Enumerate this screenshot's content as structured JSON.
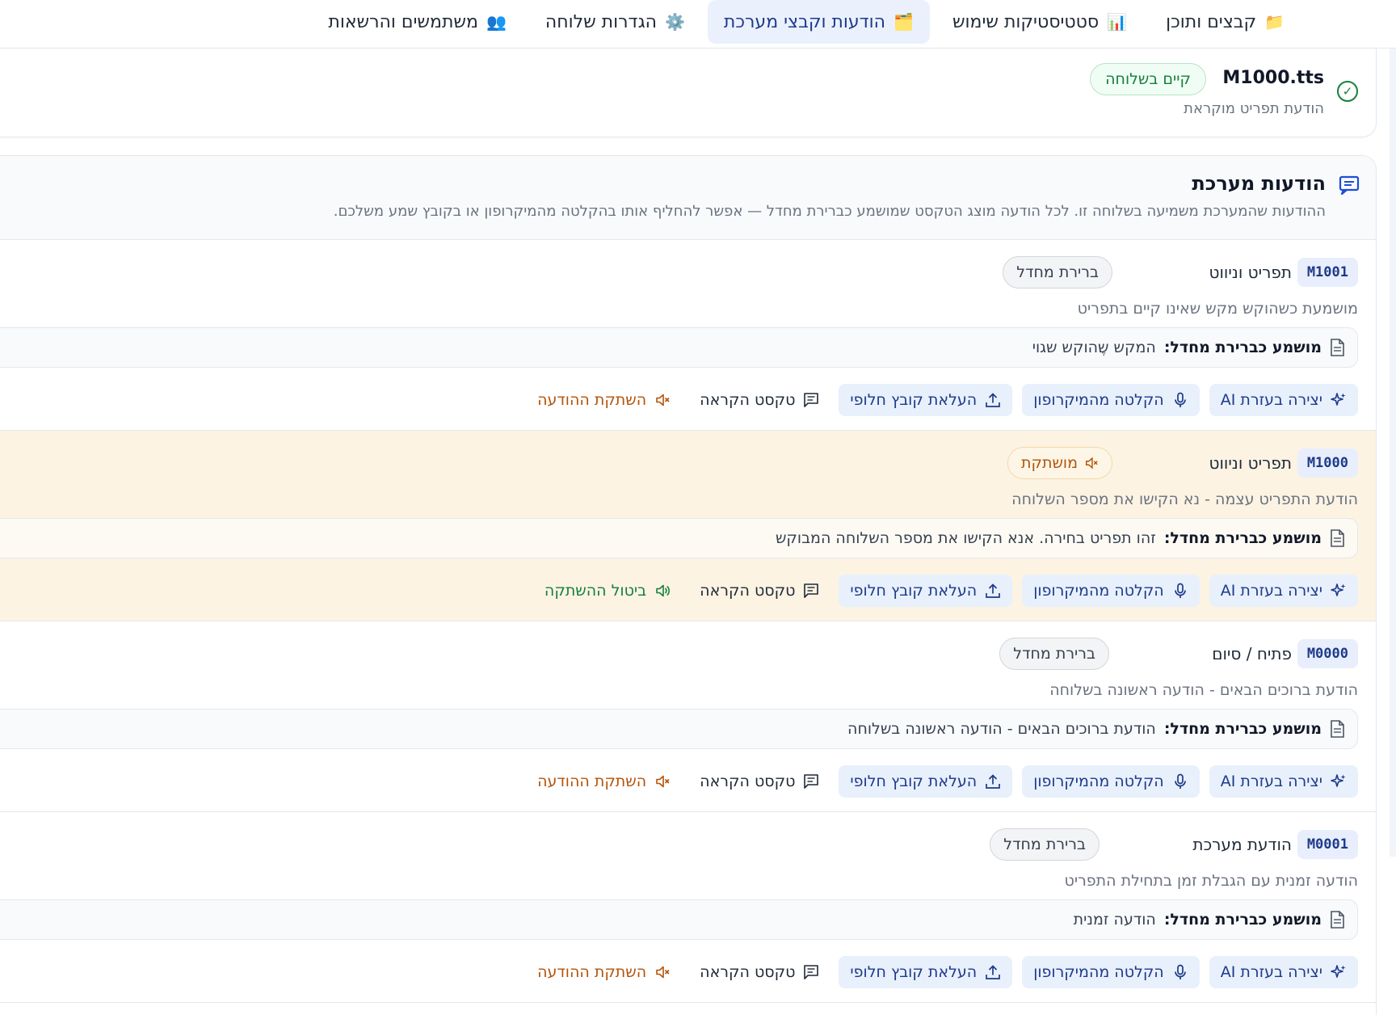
{
  "nav": {
    "tabs": [
      {
        "label": "קבצים ותוכן",
        "emoji": "📁"
      },
      {
        "label": "סטטיסטיקות שימוש",
        "emoji": "📊"
      },
      {
        "label": "הודעות וקבצי מערכת",
        "emoji": "🗂️"
      },
      {
        "label": "הגדרות שלוחה",
        "emoji": "⚙️"
      },
      {
        "label": "משתמשים והרשאות",
        "emoji": "👥"
      }
    ]
  },
  "file_card": {
    "name": "M1000.tts",
    "badge": "קיים בשלוחה",
    "subtitle": "הודעת תפריט מוקראת"
  },
  "panel": {
    "title": "הודעות מערכת",
    "description": "ההודעות שהמערכת משמיעה בשלוחה זו. לכל הודעה מוצג הטקסט שמושמע כברירת מחדל — אפשר להחליף אותו בהקלטה מהמיקרופון או בקובץ שמע משלכם."
  },
  "common": {
    "default_label": "מושמע כברירת מחדל:",
    "ai_button": "יצירה בעזרת AI",
    "record_button": "הקלטה מהמיקרופון",
    "upload_button": "העלאת קובץ חלופי",
    "tts_button": "טקסט הקראה",
    "mute_button": "השתקת ההודעה",
    "unmute_button": "ביטול ההשתקה"
  },
  "messages": [
    {
      "code": "M1001",
      "category": "תפריט וניווט",
      "status": "ברירת מחדל",
      "description": "מושמעת כשהוקש מקש שאינו קיים בתפריט",
      "default_text": "המקש שֶהוקש שגוי"
    },
    {
      "code": "M1000",
      "category": "תפריט וניווט",
      "status": "מושתקת",
      "description": "הודעת התפריט עצמה - נא הקישו את מספר השלוחה",
      "default_text": "זהו תפריט בחירה. אנא הקישו את מספר השלוחה המבוקש"
    },
    {
      "code": "M0000",
      "category": "פתיח / סיום",
      "status": "ברירת מחדל",
      "description": "הודעת ברוכים הבאים - הודעה ראשונה בשלוחה",
      "default_text": "הודעת ברוכים הבאים - הודעה ראשונה בשלוחה"
    },
    {
      "code": "M0001",
      "category": "הודעת מערכת",
      "status": "ברירת מחדל",
      "description": "הודעה זמנית עם הגבלת זמן בתחילת התפריט",
      "default_text": "הודעה זמנית"
    }
  ],
  "colors": {
    "accent": "#1e3a8a",
    "accent_bg": "#e8f0fc",
    "success": "#15803d",
    "warning": "#b45309",
    "muted_row_bg": "#fcf3e3"
  }
}
